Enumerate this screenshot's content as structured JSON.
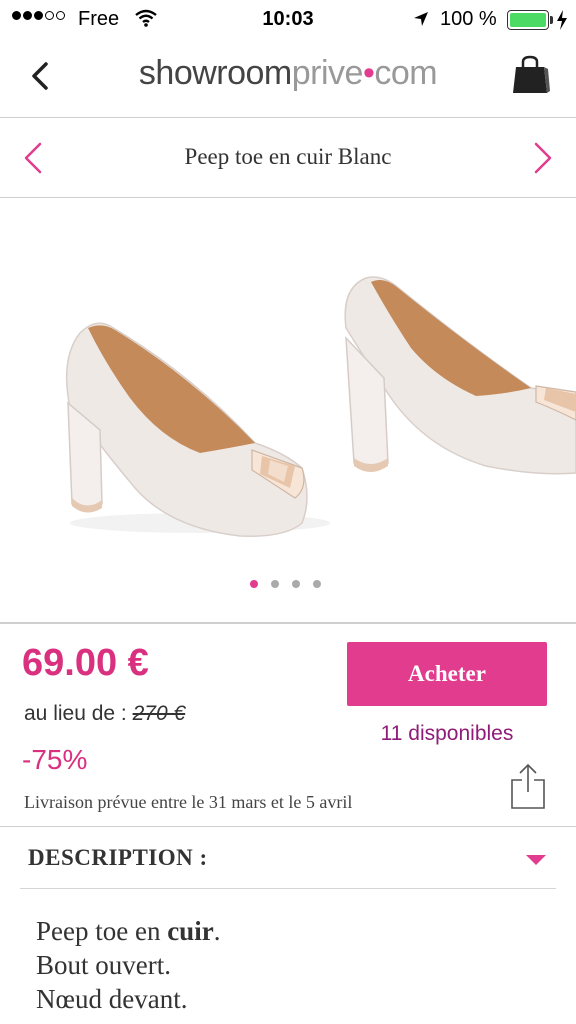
{
  "status_bar": {
    "carrier": "Free",
    "time": "10:03",
    "battery": "100 %",
    "battery_level": 1.0
  },
  "header": {
    "logo_part1": "showroom",
    "logo_part2": "prive",
    "logo_sep": "•",
    "logo_part3": "com",
    "back_icon": "chevron-left-icon",
    "bag_icon": "shopping-bag-icon"
  },
  "product": {
    "title": "Peep toe en cuir Blanc",
    "gallery_total": 4,
    "gallery_active": 1
  },
  "pricing": {
    "price": "69.00 €",
    "was_label": "au lieu de : ",
    "was_price": "270 €",
    "discount": "-75%",
    "buy_label": "Acheter",
    "stock": "11 disponibles",
    "delivery": "Livraison prévue entre le 31 mars et le 5 avril"
  },
  "description": {
    "title": "DESCRIPTION :",
    "line1_a": "Peep toe en ",
    "line1_b": "cuir",
    "line1_c": ".",
    "line2": "Bout ouvert.",
    "line3": "Nœud devant."
  },
  "colors": {
    "accent": "#e23c8e",
    "stock": "#8f1c78",
    "battery": "#4cd964"
  }
}
